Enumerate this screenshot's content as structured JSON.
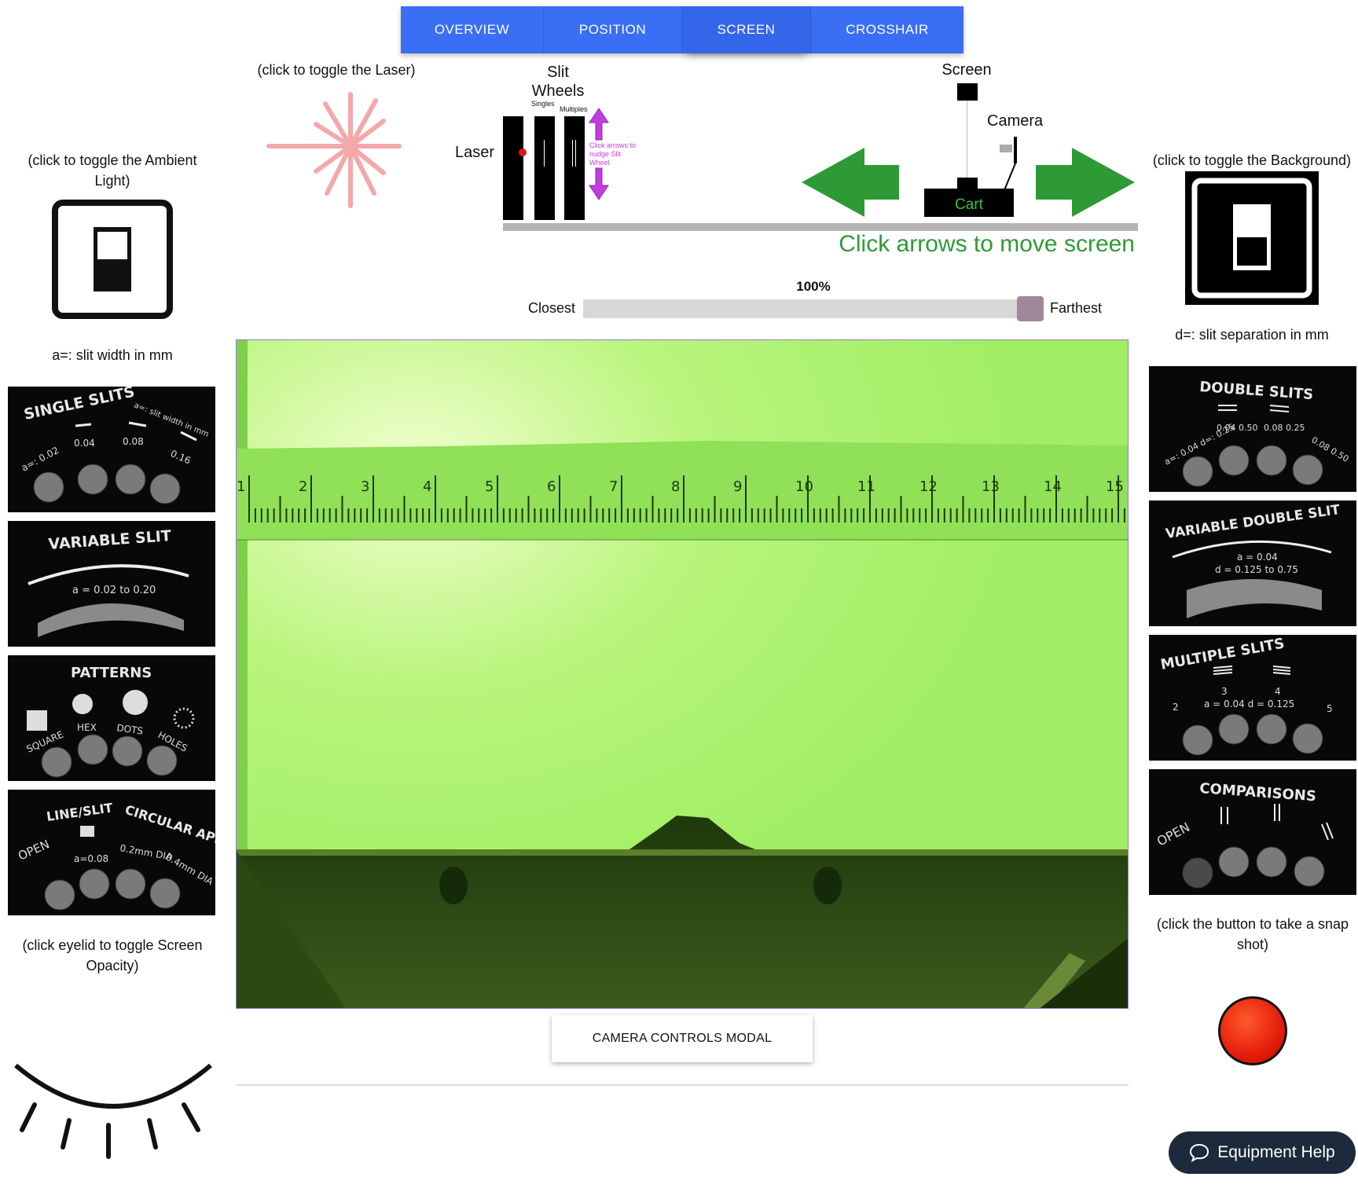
{
  "tabs": [
    {
      "label": "OVERVIEW",
      "active": false
    },
    {
      "label": "POSITION",
      "active": false
    },
    {
      "label": "SCREEN",
      "active": true
    },
    {
      "label": "CROSSHAIR",
      "active": false
    }
  ],
  "ambient": {
    "caption": "(click to toggle the Ambient Light)"
  },
  "laser": {
    "caption": "(click to toggle the Laser)"
  },
  "background": {
    "caption": "(click to toggle the Background)"
  },
  "diagram": {
    "slit_wheels": "Slit Wheels",
    "singles": "Singles",
    "multiples": "Multiples",
    "laser": "Laser",
    "nudge_hint": "Click arrows to nudge Slit Wheel",
    "screen": "Screen",
    "camera": "Camera",
    "cart": "Cart",
    "move_hint": "Click arrows to move screen"
  },
  "position": {
    "percent_label": "100%",
    "value": 1.0,
    "closest": "Closest",
    "farthest": "Farthest"
  },
  "left_wheels": {
    "caption": "a=: slit width in mm",
    "single_slits": {
      "title": "SINGLE SLITS",
      "note": "a=: slit width in mm",
      "a_prefix": "a=: 0.02",
      "v2": "0.04",
      "v3": "0.08",
      "v4": "0.16"
    },
    "variable_slit": {
      "title": "VARIABLE SLIT",
      "range": "a = 0.02 to 0.20"
    },
    "patterns": {
      "title": "PATTERNS",
      "labels": [
        "SQUARE",
        "HEX",
        "DOTS",
        "HOLES"
      ]
    },
    "line_slit": {
      "title": "LINE/SLIT",
      "title2": "CIRCULAR APERTURES",
      "open": "OPEN",
      "a": "a=0.08",
      "dia1": "0.2mm DIA",
      "dia2": "0.4mm DIA"
    }
  },
  "right_wheels": {
    "caption": "d=: slit separation in mm",
    "double_slits": {
      "title": "DOUBLE SLITS",
      "l1": "a=: 0.04 d=: 0.25",
      "l2": "0.04 0.50",
      "l3": "0.08 0.25",
      "l4": "0.08 0.50"
    },
    "variable_double": {
      "title": "VARIABLE DOUBLE SLIT",
      "a": "a = 0.04",
      "d": "d = 0.125 to 0.75"
    },
    "multiple_slits": {
      "title": "MULTIPLE SLITS",
      "n2": "2",
      "n3": "3",
      "n4": "4",
      "n5": "5",
      "ad": "a = 0.04  d = 0.125"
    },
    "comparisons": {
      "title": "COMPARISONS",
      "open": "OPEN"
    }
  },
  "eyelid": {
    "caption": "(click eyelid to toggle Screen Opacity)"
  },
  "snapshot": {
    "caption": "(click the button to take a snap shot)"
  },
  "ruler_numbers": [
    "1",
    "2",
    "3",
    "4",
    "5",
    "6",
    "7",
    "8",
    "9",
    "10",
    "11",
    "12",
    "13",
    "14",
    "15"
  ],
  "camera_button": "CAMERA CONTROLS MODAL",
  "help_button": "Equipment Help",
  "colors": {
    "tab_blue": "#3a6ff5",
    "arrow_green": "#2e9a35",
    "nudge_magenta": "#c43be0",
    "screen_green": "#a6f06a",
    "record_red": "#ef2d10"
  }
}
